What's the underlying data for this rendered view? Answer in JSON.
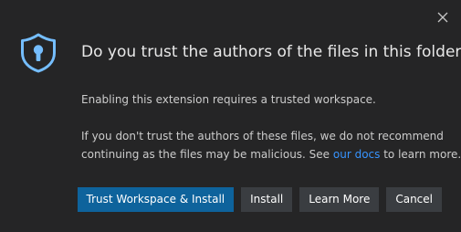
{
  "dialog": {
    "title": "Do you trust the authors of the files in this folder?",
    "message_1": "Enabling this extension requires a trusted workspace.",
    "message_2_line1": "If you don't trust the authors of these files, we do not recommend",
    "message_2_line2_before": "continuing as the files may be malicious. See ",
    "message_2_link": "our docs",
    "message_2_line2_after": " to learn more.",
    "icon": "shield-keyhole-icon",
    "close_icon": "close-icon"
  },
  "buttons": {
    "trust_install": "Trust Workspace & Install",
    "install": "Install",
    "learn_more": "Learn More",
    "cancel": "Cancel"
  },
  "colors": {
    "background": "#252526",
    "accent": "#0e639c",
    "secondary_button": "#3a3d41",
    "link": "#3794ff",
    "icon": "#75beff"
  }
}
